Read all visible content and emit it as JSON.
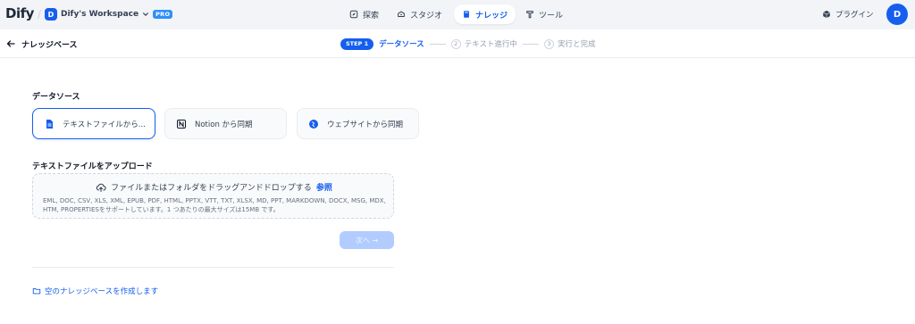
{
  "header": {
    "logo": "Dify",
    "workspace": {
      "initial": "D",
      "name": "Dify's Workspace",
      "plan_badge": "PRO"
    },
    "nav": [
      {
        "label": "探索",
        "icon": "compass-icon",
        "active": false
      },
      {
        "label": "スタジオ",
        "icon": "studio-icon",
        "active": false
      },
      {
        "label": "ナレッジ",
        "icon": "book-icon",
        "active": true
      },
      {
        "label": "ツール",
        "icon": "wrench-icon",
        "active": false
      }
    ],
    "plugin_label": "プラグイン",
    "user_initial": "D"
  },
  "subheader": {
    "title": "ナレッジベース",
    "steps": [
      {
        "badge": "STEP 1",
        "label": "データソース",
        "active": true
      },
      {
        "number": "2",
        "label": "テキスト進行中",
        "active": false
      },
      {
        "number": "3",
        "label": "実行と完成",
        "active": false
      }
    ]
  },
  "main": {
    "data_source_title": "データソース",
    "sources": [
      {
        "label": "テキストファイルから...",
        "icon": "file-icon",
        "selected": true
      },
      {
        "label": "Notion から同期",
        "icon": "notion-icon",
        "selected": false
      },
      {
        "label": "ウェブサイトから同期",
        "icon": "globe-icon",
        "selected": false
      }
    ],
    "upload_title": "テキストファイルをアップロード",
    "dropzone": {
      "main_text": "ファイルまたはフォルダをドラッグアンドドロップする",
      "browse_link": "参照",
      "support_text": "EML, DOC, CSV, XLS, XML, EPUB, PDF, HTML, PPTX, VTT, TXT, XLSX, MD, PPT, MARKDOWN, DOCX, MSG, MDX, HTM, PROPERTIESをサポートしています。1 つあたりの最大サイズは15MB です。"
    },
    "next_button": "次へ →",
    "create_empty_link": "空のナレッジベースを作成します"
  },
  "colors": {
    "accent": "#155eef",
    "nav_bg": "#f2f4f7",
    "disabled_button": "#b2ccff"
  }
}
